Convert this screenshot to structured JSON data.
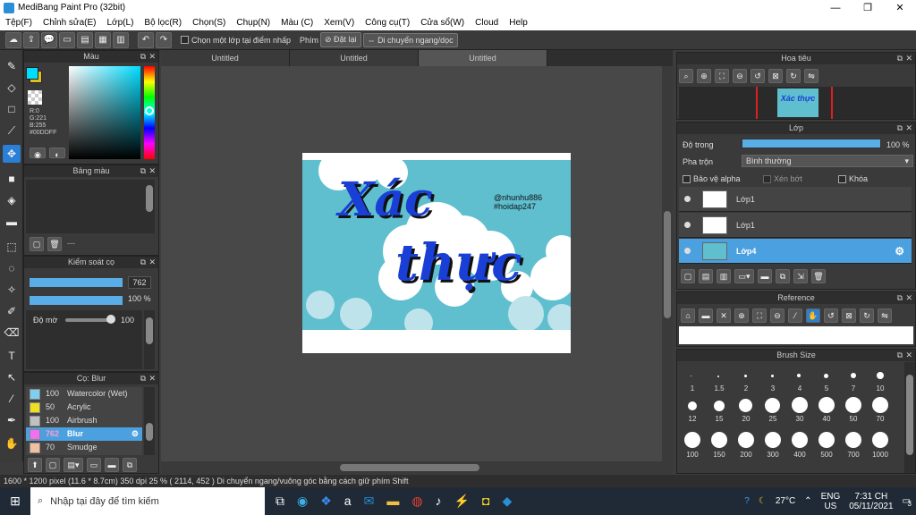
{
  "app": {
    "title": "MediBang Paint Pro (32bit)"
  },
  "window_controls": {
    "minimize": "—",
    "restore": "❐",
    "close": "✕"
  },
  "menu": [
    "Tệp(F)",
    "Chỉnh sửa(E)",
    "Lớp(L)",
    "Bộ lọc(R)",
    "Chọn(S)",
    "Chụp(N)",
    "Màu (C)",
    "Xem(V)",
    "Công cụ(T)",
    "Cửa sổ(W)",
    "Cloud",
    "Help"
  ],
  "toolbar": {
    "select_layer_label": "Chọn một lớp tại điểm nhấp",
    "key_label": "Phím",
    "reset_label": "Đặt lại",
    "move_label": "Di chuyển ngang/dọc"
  },
  "doc_tabs": [
    "Untitled",
    "Untitled",
    "Untitled"
  ],
  "color_panel": {
    "title": "Màu",
    "r": "R:0",
    "g": "G:221",
    "b": "B:255",
    "hex": "#00DDFF",
    "fg_color": "#00ddff",
    "bg_color": "#e0c020"
  },
  "palette_panel": {
    "title": "Bảng màu",
    "dash": "---"
  },
  "brush_control": {
    "title": "Kiểm soát cọ",
    "size_value": "762",
    "opacity_value": "100 %",
    "density_label": "Độ mờ",
    "density_value": "100"
  },
  "brush_panel": {
    "title": "Cọ: Blur",
    "items": [
      {
        "size": "100",
        "name": "Watercolor (Wet)",
        "color": "#7fd0f0"
      },
      {
        "size": "50",
        "name": "Acrylic",
        "color": "#f0e020"
      },
      {
        "size": "100",
        "name": "Airbrush",
        "color": "#c0c0c0"
      },
      {
        "size": "762",
        "name": "Blur",
        "color": "#f070f0",
        "active": true
      },
      {
        "size": "70",
        "name": "Smudge",
        "color": "#f0c0a0"
      }
    ]
  },
  "canvas_art": {
    "handle_line1": "@nhunhu886",
    "handle_line2": "#hoidap247",
    "word1": "Xác",
    "word2": "thực"
  },
  "navigator": {
    "title": "Hoa tiêu",
    "thumb_text": "Xác thực"
  },
  "layers": {
    "title": "Lớp",
    "opacity_label": "Độ trong",
    "opacity_value": "100 %",
    "blend_label": "Pha trộn",
    "blend_value": "Bình thường",
    "protect_alpha": "Bảo vệ alpha",
    "clipping": "Xén bớt",
    "lock": "Khóa",
    "items": [
      {
        "name": "Lớp1",
        "active": false
      },
      {
        "name": "Lớp1",
        "active": false
      },
      {
        "name": "Lớp4",
        "active": true
      }
    ]
  },
  "reference": {
    "title": "Reference"
  },
  "brush_size": {
    "title": "Brush Size",
    "sizes": [
      "1",
      "1.5",
      "2",
      "3",
      "4",
      "5",
      "7",
      "10",
      "12",
      "15",
      "20",
      "25",
      "30",
      "40",
      "50",
      "70",
      "100",
      "150",
      "200",
      "300",
      "400",
      "500",
      "700",
      "1000"
    ]
  },
  "status": {
    "text": "1600 * 1200 pixel  (11.6 * 8.7cm)  350 dpi  25 %  ( 2114, 452 )  Di chuyển ngang/vuông góc bằng cách giữ phím Shift"
  },
  "taskbar": {
    "search_placeholder": "Nhập tại đây để tìm kiếm",
    "weather": "27°C",
    "lang1": "ENG",
    "lang2": "US",
    "time": "7:31 CH",
    "date": "05/11/2021",
    "notif_count": "3"
  }
}
